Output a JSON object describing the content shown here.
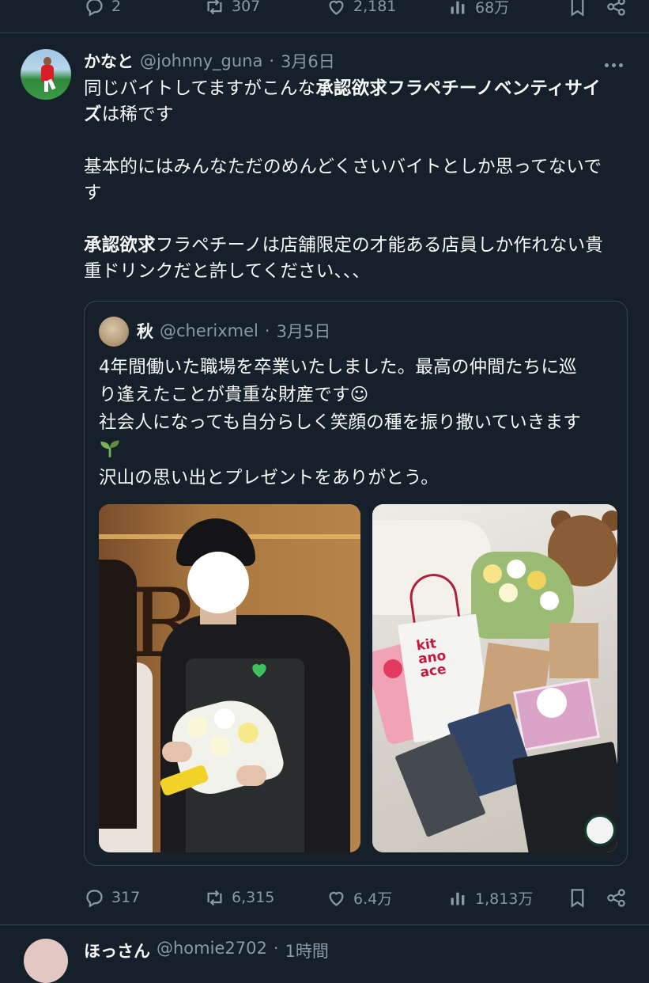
{
  "prev_actions": {
    "replies": "2",
    "retweets": "307",
    "likes": "2,181",
    "views": "68万"
  },
  "tweet": {
    "name": "かなと",
    "handle": "@johnny_guna",
    "dot": "·",
    "date": "3月6日",
    "text": {
      "l1_pre": "同じバイトしてますがこんな",
      "l1_bold": "承認欲求フラペチーノベンティサイ",
      "l2_bold": "ズ",
      "l2_post": "は稀です",
      "l3": "基本的にはみんなただのめんどくさいバイトとしか思ってないで",
      "l4": "す",
      "l5_bold": "承認欲求",
      "l5_post": "フラペチーノは店舗限定の才能ある店員しか作れない貴",
      "l6": "重ドリンクだと許してください、、、"
    },
    "quote": {
      "name": "秋",
      "handle": "@cherixmel",
      "dot": "·",
      "date": "3月5日",
      "l1": "4年間働いた職場を卒業いたしました。最高の仲間たちに巡",
      "l2": "り逢えたことが貴重な財産です☺",
      "l3": "社会人になっても自分らしく笑顔の種を振り撒いていきます",
      "l5": "沢山の思い出とプレゼントをありがとう。",
      "bag_text": "kit ano ace"
    },
    "actions": {
      "replies": "317",
      "retweets": "6,315",
      "likes": "6.4万",
      "views": "1,813万"
    }
  },
  "next_tweet": {
    "name": "ほっさん",
    "handle": "@homie2702",
    "dot": "·",
    "time": "1時間"
  },
  "colors": {
    "background": "#15202b",
    "text": "#f7f9f9",
    "muted": "#8b98a5",
    "border": "#38444d"
  }
}
